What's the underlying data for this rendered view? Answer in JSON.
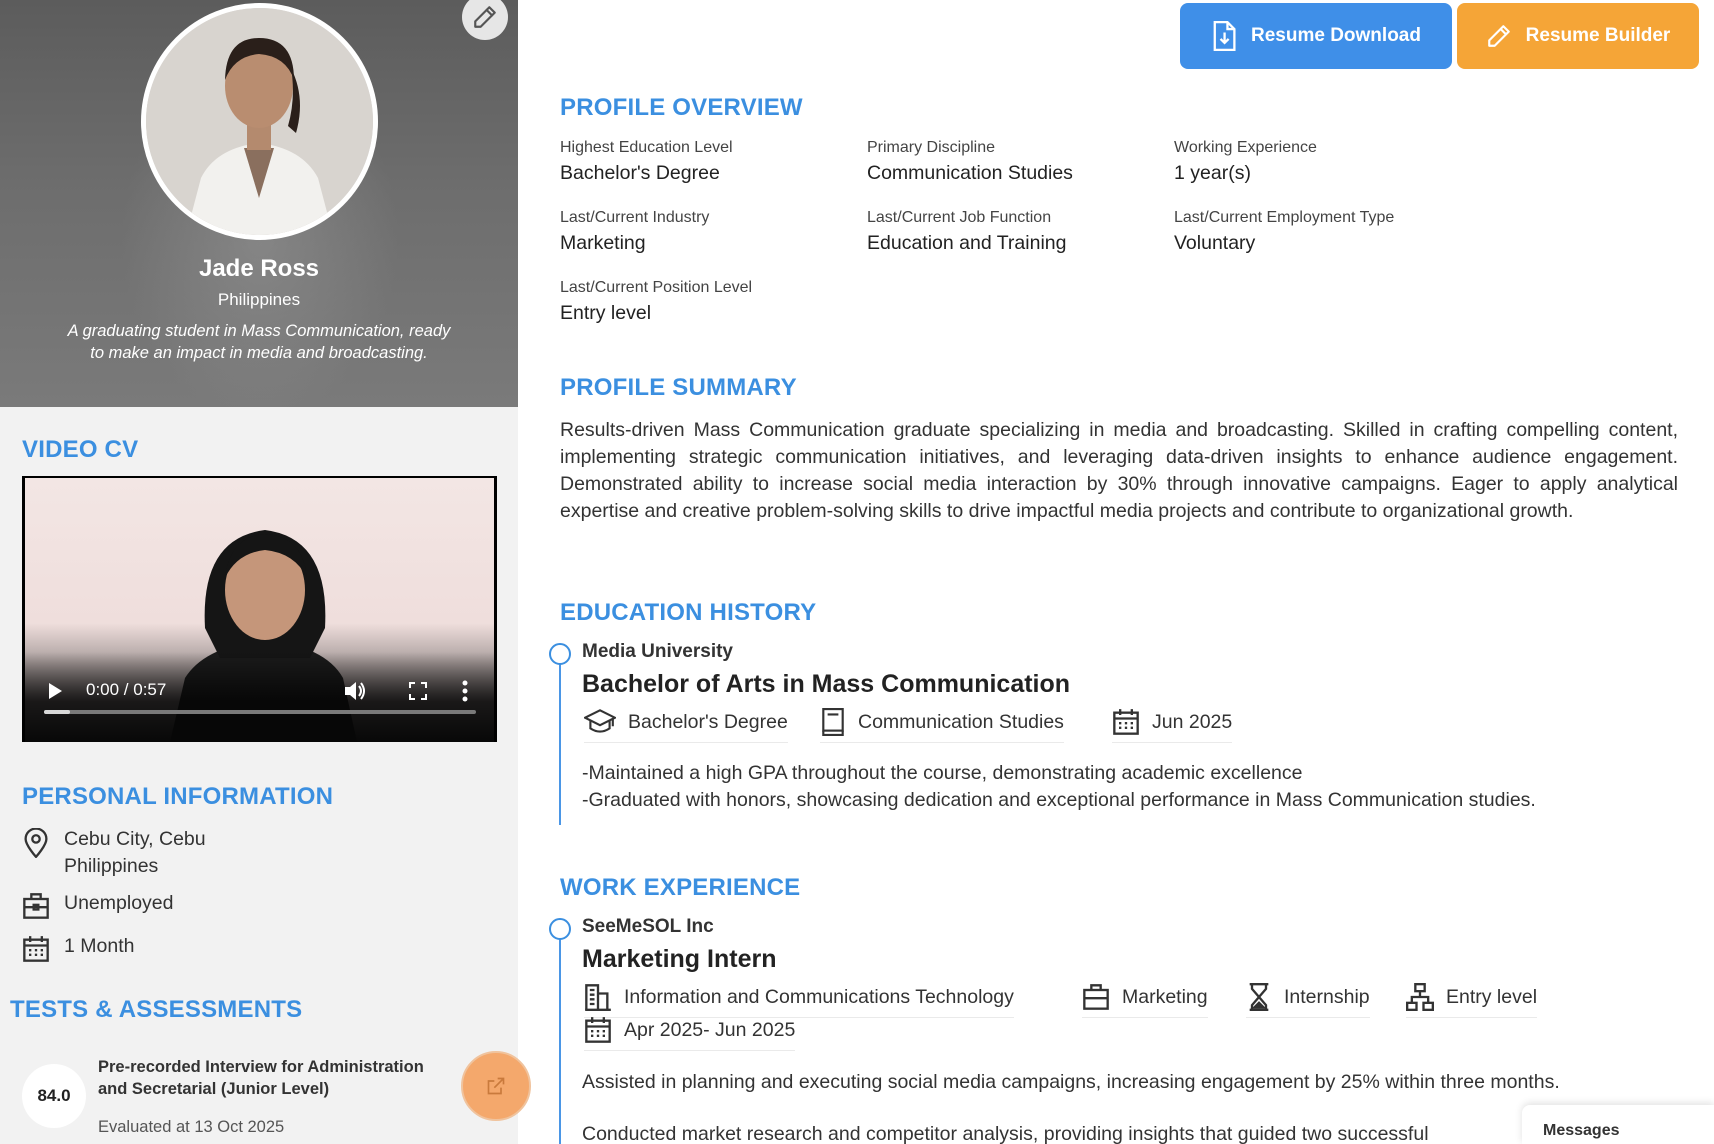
{
  "header_buttons": {
    "resume_download": "Resume Download",
    "resume_builder": "Resume Builder"
  },
  "profile": {
    "name": "Jade Ross",
    "country": "Philippines",
    "bio": "A graduating student in Mass Communication, ready to make an impact in media and broadcasting."
  },
  "sections": {
    "video_cv": "VIDEO CV",
    "personal_information": "PERSONAL INFORMATION",
    "tests_assessments": "TESTS & ASSESSMENTS",
    "profile_overview": "PROFILE OVERVIEW",
    "profile_summary": "PROFILE SUMMARY",
    "education_history": "EDUCATION HISTORY",
    "work_experience": "WORK EXPERIENCE"
  },
  "video": {
    "time": "0:00 / 0:57",
    "progress_fraction": 0.06
  },
  "personal_info": {
    "location_line1": "Cebu City, Cebu",
    "location_line2": "Philippines",
    "employment_status": "Unemployed",
    "availability": "1 Month"
  },
  "test": {
    "score": "84.0",
    "name": "Pre-recorded Interview for Administration and Secretarial (Junior Level)",
    "evaluated": "Evaluated at 13 Oct 2025"
  },
  "overview": [
    {
      "label": "Highest Education Level",
      "value": "Bachelor's Degree"
    },
    {
      "label": "Primary Discipline",
      "value": "Communication Studies"
    },
    {
      "label": "Working Experience",
      "value": "1 year(s)"
    },
    {
      "label": "Last/Current Industry",
      "value": "Marketing"
    },
    {
      "label": "Last/Current Job Function",
      "value": "Education and Training"
    },
    {
      "label": "Last/Current Employment Type",
      "value": "Voluntary"
    },
    {
      "label": "Last/Current Position Level",
      "value": "Entry level"
    }
  ],
  "summary": "Results-driven Mass Communication graduate specializing in media and broadcasting. Skilled in crafting compelling content, implementing strategic communication initiatives, and leveraging data-driven insights to enhance audience engagement. Demonstrated ability to increase social media interaction by 30% through innovative campaigns. Eager to apply analytical expertise and creative problem-solving skills to drive impactful media projects and contribute to organizational growth.",
  "education": {
    "school": "Media University",
    "degree": "Bachelor of Arts in Mass Communication",
    "level": "Bachelor's Degree",
    "discipline": "Communication Studies",
    "graduation": "Jun 2025",
    "desc1": "-Maintained a high GPA throughout the course, demonstrating academic excellence",
    "desc2": "-Graduated with honors, showcasing dedication and exceptional performance in Mass Communication studies."
  },
  "work": {
    "company": "SeeMeSOL Inc",
    "title": "Marketing Intern",
    "industry": "Information and Communications Technology",
    "function": "Marketing",
    "type": "Internship",
    "level": "Entry level",
    "period": "Apr 2025- Jun 2025",
    "desc1": "Assisted in planning and executing social media campaigns, increasing engagement by 25% within three months.",
    "desc2": "Conducted market research and competitor analysis, providing insights that guided two successful"
  },
  "messages_label": "Messages",
  "colors": {
    "accent_blue": "#3b8fe0",
    "button_blue": "#3f8fe8",
    "button_orange": "#f5a537"
  }
}
